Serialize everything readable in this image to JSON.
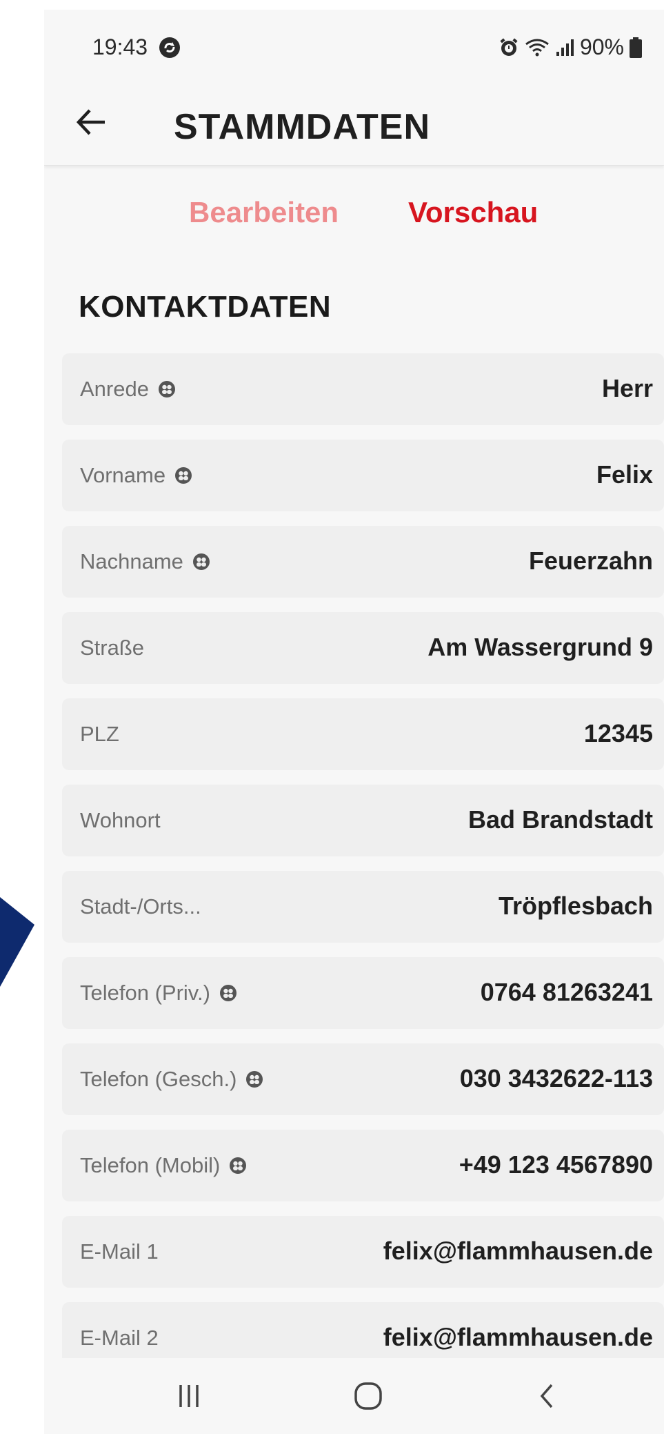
{
  "status_bar": {
    "time": "19:43",
    "battery": "90%"
  },
  "app_bar": {
    "title": "STAMMDATEN"
  },
  "tabs": [
    {
      "label": "Bearbeiten"
    },
    {
      "label": "Vorschau"
    }
  ],
  "section": {
    "title": "KONTAKTDATEN"
  },
  "rows": [
    {
      "label": "Anrede",
      "value": "Herr",
      "icon": "privacy-icon"
    },
    {
      "label": "Vorname",
      "value": "Felix",
      "icon": "privacy-icon"
    },
    {
      "label": "Nachname",
      "value": "Feuerzahn",
      "icon": "privacy-icon"
    },
    {
      "label": "Straße",
      "value": "Am Wassergrund 9",
      "icon": null
    },
    {
      "label": "PLZ",
      "value": "12345",
      "icon": null
    },
    {
      "label": "Wohnort",
      "value": "Bad Brandstadt",
      "icon": null
    },
    {
      "label": "Stadt-/Orts...",
      "value": "Tröpflesbach",
      "icon": null
    },
    {
      "label": "Telefon (Priv.)",
      "value": "0764 81263241",
      "icon": "privacy-icon"
    },
    {
      "label": "Telefon (Gesch.)",
      "value": "030 3432622-113",
      "icon": "privacy-icon"
    },
    {
      "label": "Telefon (Mobil)",
      "value": "+49 123 4567890",
      "icon": "privacy-icon"
    },
    {
      "label": "E-Mail 1",
      "value": "felix@flammhausen.de",
      "icon": null
    },
    {
      "label": "E-Mail 2",
      "value": "felix@flammhausen.de",
      "icon": null
    }
  ],
  "colors": {
    "tab_inactive": "#ee8b8d",
    "tab_active": "#d7151f",
    "accent_blue": "#0e2a6e"
  }
}
